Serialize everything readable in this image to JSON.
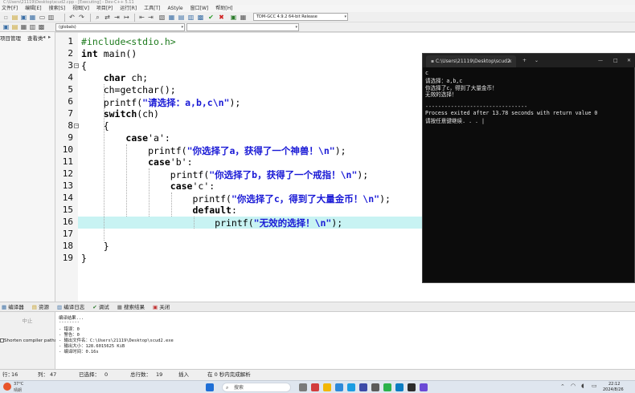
{
  "window": {
    "title": "C:\\Users\\21119\\Desktop\\scud2.cpp - [Executing] - Dev-C++ 5.11"
  },
  "menu": [
    "文件[F]",
    "编辑[E]",
    "搜索[S]",
    "视图[V]",
    "项目[P]",
    "运行[R]",
    "工具[T]",
    "AStyle",
    "窗口[W]",
    "帮助[H]"
  ],
  "toolbar": {
    "compiler": "TDM-GCC 4.9.2 64-bit Release",
    "scope": "(globals)"
  },
  "left_panel": {
    "tabs": [
      "项目管理",
      "查看类"
    ]
  },
  "editor": {
    "lines": [
      {
        "n": "1",
        "text": "#include<stdio.h>"
      },
      {
        "n": "2",
        "text": "int main()"
      },
      {
        "n": "3",
        "text": "{"
      },
      {
        "n": "4",
        "text": "    char ch;"
      },
      {
        "n": "5",
        "text": "    ch=getchar();"
      },
      {
        "n": "6",
        "text": "    printf(\"请选择：a,b,c\\n\");"
      },
      {
        "n": "7",
        "text": "    switch(ch)"
      },
      {
        "n": "8",
        "text": "    {"
      },
      {
        "n": "9",
        "text": "        case'a':"
      },
      {
        "n": "10",
        "text": "            printf(\"你选择了a，获得了一个神兽！\\n\");"
      },
      {
        "n": "11",
        "text": "            case'b':"
      },
      {
        "n": "12",
        "text": "                printf(\"你选择了b，获得了一个戒指！\\n\");"
      },
      {
        "n": "13",
        "text": "                case'c':"
      },
      {
        "n": "14",
        "text": "                    printf(\"你选择了c，得到了大量金币！\\n\");"
      },
      {
        "n": "15",
        "text": "                    default:"
      },
      {
        "n": "16",
        "text": "                        printf(\"无效的选择！\\n\");"
      },
      {
        "n": "17",
        "text": ""
      },
      {
        "n": "18",
        "text": "    }"
      },
      {
        "n": "19",
        "text": "}"
      }
    ]
  },
  "console": {
    "tab_title": "C:\\Users\\21119\\Desktop\\scud2.",
    "lines": [
      "c",
      "请选择：a,b,c",
      "你选择了c，得到了大量金币！",
      "无效的选择！",
      "",
      "--------------------------------",
      "Process exited after 13.78 seconds with return value 0",
      "请按任意键继续. . . |"
    ]
  },
  "bottom_tabs": [
    "编译器",
    "资源",
    "编译日志",
    "调试",
    "搜索结果",
    "关闭"
  ],
  "bottom_left": {
    "abort": "中止",
    "shorten": "Shorten compiler paths"
  },
  "log": [
    "编译结果...",
    "--------",
    "- 错误：0",
    "- 警告：0",
    "- 输出文件名：C:\\Users\\21119\\Desktop\\scud2.exe",
    "- 输出大小：128.6015625 KiB",
    "- 编译时间：0.16s"
  ],
  "status": {
    "row_label": "行：",
    "row": "16",
    "col_label": "列：",
    "col": "47",
    "sel_label": "已选择：",
    "sel": "0",
    "total_label": "总行数：",
    "total": "19",
    "mode": "插入",
    "parse": "在 0 秒内完成解析"
  },
  "taskbar": {
    "weather": "37°C",
    "weather_sub": "晴朗",
    "search": "搜索",
    "time": "22:12",
    "date": "2024/8/26"
  }
}
